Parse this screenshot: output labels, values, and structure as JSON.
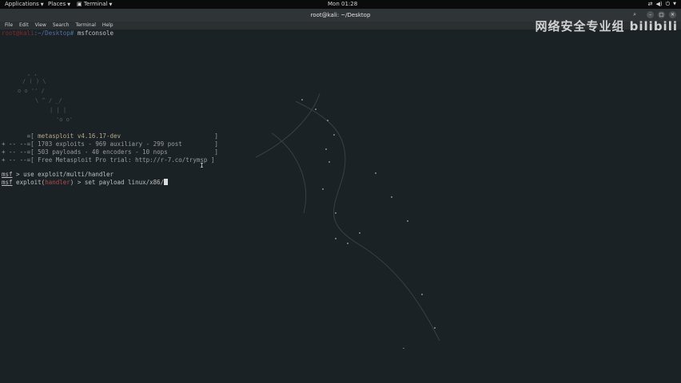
{
  "topbar": {
    "applications": "Applications",
    "places": "Places",
    "terminal": "Terminal",
    "clock": "Mon 01:28"
  },
  "window": {
    "title": "root@kali: ~/Desktop"
  },
  "menu": [
    "File",
    "Edit",
    "View",
    "Search",
    "Terminal",
    "Help"
  ],
  "watermark": "网络安全专业组 bilibili",
  "terminal": {
    "prompt_host": "root@kali",
    "prompt_path": ":~/Desktop#",
    "first_command": " msfconsole",
    "banner": [
      {
        "prefix": "       =[ ",
        "text": "metasploit v4.16.17-dev",
        "suffix": "                          ]"
      },
      {
        "prefix": "+ -- --=[ ",
        "text": "1703 exploits - 969 auxiliary - 299 post",
        "suffix": "         ]"
      },
      {
        "prefix": "+ -- --=[ ",
        "text": "503 payloads - 40 encoders - 10 nops",
        "suffix": "             ]"
      },
      {
        "prefix": "+ -- --=[ ",
        "text": "Free Metasploit Pro trial: http://r-7.co/trymsp",
        "suffix": " ]"
      }
    ],
    "msf_label": "msf",
    "cmd1": " > use exploit/multi/handler",
    "cmd2_prefix": " exploit(",
    "cmd2_module": "handler",
    "cmd2_suffix": ") > set payload linux/x86/"
  }
}
